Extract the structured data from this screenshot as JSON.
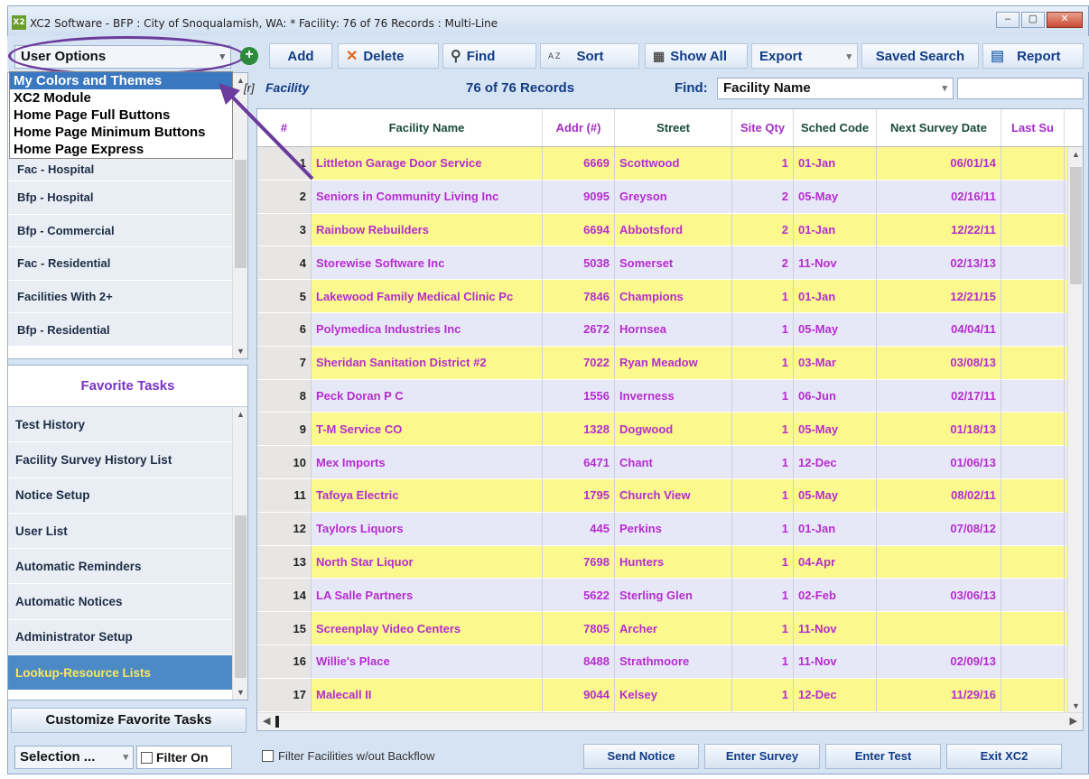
{
  "window": {
    "title": "XC2 Software - BFP : City of Snoqualamish, WA: * Facility: 76 of 76 Records : Multi-Line",
    "app_icon": "X2",
    "controls": [
      "–",
      "▢",
      "✕"
    ]
  },
  "toolbar": {
    "user_options": "User Options",
    "add": "Add",
    "delete": "Delete",
    "find": "Find",
    "sort": "Sort",
    "sort_icon_text": "A Z",
    "show_all": "Show All",
    "export": "Export",
    "saved_search": "Saved Search",
    "report": "Report"
  },
  "user_options_menu": [
    "My Colors and Themes",
    "XC2 Module",
    "Home Page Full Buttons",
    "Home Page Minimum Buttons",
    "Home Page Express"
  ],
  "saved_views": [
    "Fac - Hospital",
    "Bfp - Hospital",
    "Bfp - Commercial",
    "Fac - Residential",
    "Facilities With 2+",
    "Bfp - Residential"
  ],
  "favorite_tasks": {
    "header": "Favorite Tasks",
    "items": [
      "Test History",
      "Facility Survey History List",
      "Notice Setup",
      "User List",
      "Automatic Reminders",
      "Automatic Notices",
      "Administrator Setup",
      "Lookup-Resource Lists"
    ],
    "selected": "Lookup-Resource Lists"
  },
  "customize_button": "Customize Favorite Tasks",
  "grid_toolbar": {
    "ellipsis": "...",
    "r_tag": "[r]",
    "entity": "Facility",
    "records": "76 of 76 Records",
    "find_label": "Find:",
    "find_field": "Facility Name",
    "find_value": ""
  },
  "grid": {
    "columns": [
      "#",
      "Facility Name",
      "Addr (#)",
      "Street",
      "Site Qty",
      "Sched Code",
      "Next Survey Date",
      "Last Su"
    ],
    "rows": [
      [
        "1",
        "Littleton Garage Door Service",
        "6669",
        "Scottwood",
        "1",
        "01-Jan",
        "06/01/14"
      ],
      [
        "2",
        "Seniors in Community Living Inc",
        "9095",
        "Greyson",
        "2",
        "05-May",
        "02/16/11"
      ],
      [
        "3",
        "Rainbow Rebuilders",
        "6694",
        "Abbotsford",
        "2",
        "01-Jan",
        "12/22/11"
      ],
      [
        "4",
        "Storewise Software Inc",
        "5038",
        "Somerset",
        "2",
        "11-Nov",
        "02/13/13"
      ],
      [
        "5",
        "Lakewood Family Medical Clinic Pc",
        "7846",
        "Champions",
        "1",
        "01-Jan",
        "12/21/15"
      ],
      [
        "6",
        "Polymedica Industries Inc",
        "2672",
        "Hornsea",
        "1",
        "05-May",
        "04/04/11"
      ],
      [
        "7",
        "Sheridan Sanitation District #2",
        "7022",
        "Ryan Meadow",
        "1",
        "03-Mar",
        "03/08/13"
      ],
      [
        "8",
        "Peck Doran P C",
        "1556",
        "Inverness",
        "1",
        "06-Jun",
        "02/17/11"
      ],
      [
        "9",
        "T-M Service CO",
        "1328",
        "Dogwood",
        "1",
        "05-May",
        "01/18/13"
      ],
      [
        "10",
        "Mex Imports",
        "6471",
        "Chant",
        "1",
        "12-Dec",
        "01/06/13"
      ],
      [
        "11",
        "Tafoya Electric",
        "1795",
        "Church View",
        "1",
        "05-May",
        "08/02/11"
      ],
      [
        "12",
        "Taylors Liquors",
        "445",
        "Perkins",
        "1",
        "01-Jan",
        "07/08/12"
      ],
      [
        "13",
        "North Star Liquor",
        "7698",
        "Hunters",
        "1",
        "04-Apr",
        ""
      ],
      [
        "14",
        "LA Salle Partners",
        "5622",
        "Sterling Glen",
        "1",
        "02-Feb",
        "03/06/13"
      ],
      [
        "15",
        "Screenplay Video Centers",
        "7805",
        "Archer",
        "1",
        "11-Nov",
        ""
      ],
      [
        "16",
        "Willie's Place",
        "8488",
        "Strathmoore",
        "1",
        "11-Nov",
        "02/09/13"
      ],
      [
        "17",
        "Malecall II",
        "9044",
        "Kelsey",
        "1",
        "12-Dec",
        "11/29/16"
      ]
    ]
  },
  "bottom_bar": {
    "selection": "Selection ...",
    "filter_on": "Filter On",
    "filter_facilities": "Filter Facilities w/out Backflow",
    "send_notice": "Send Notice",
    "enter_survey": "Enter Survey",
    "enter_test": "Enter Test",
    "exit": "Exit XC2"
  }
}
